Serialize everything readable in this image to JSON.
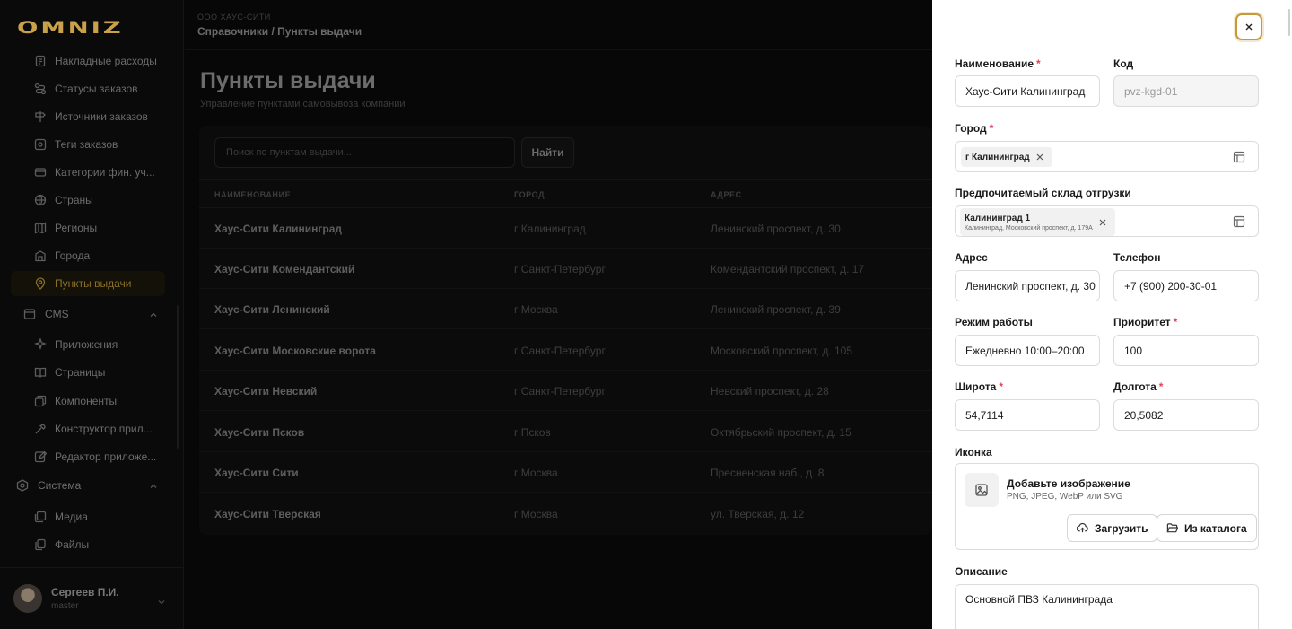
{
  "app": {
    "logo": "OMNIZ"
  },
  "sidebar": {
    "items": [
      {
        "label": "Накладные расходы",
        "icon": "receipt-icon"
      },
      {
        "label": "Статусы заказов",
        "icon": "route-icon"
      },
      {
        "label": "Источники заказов",
        "icon": "signpost-icon"
      },
      {
        "label": "Теги заказов",
        "icon": "tag-icon"
      },
      {
        "label": "Категории фин. уч...",
        "icon": "wallet-icon"
      },
      {
        "label": "Страны",
        "icon": "globe-icon"
      },
      {
        "label": "Регионы",
        "icon": "map-icon"
      },
      {
        "label": "Города",
        "icon": "building-icon"
      },
      {
        "label": "Пункты выдачи",
        "icon": "pin-icon",
        "active": true
      }
    ],
    "cms": {
      "label": "CMS",
      "items": [
        {
          "label": "Приложения",
          "icon": "sparkle-icon"
        },
        {
          "label": "Страницы",
          "icon": "book-icon"
        },
        {
          "label": "Компоненты",
          "icon": "puzzle-icon"
        },
        {
          "label": "Конструктор прил...",
          "icon": "tools-icon"
        },
        {
          "label": "Редактор приложе...",
          "icon": "edit-icon"
        }
      ]
    },
    "system": {
      "label": "Система",
      "items": [
        {
          "label": "Медиа",
          "icon": "images-icon"
        },
        {
          "label": "Файлы",
          "icon": "files-icon"
        }
      ]
    },
    "user": {
      "name": "Сергеев П.И.",
      "role": "master"
    }
  },
  "header": {
    "company": "ООО ХАУС-СИТИ",
    "breadcrumb": "Справочники / Пункты выдачи"
  },
  "page": {
    "title": "Пункты выдачи",
    "subtitle": "Управление пунктами самовывоза компании"
  },
  "search": {
    "placeholder": "Поиск по пунктам выдачи...",
    "button": "Найти"
  },
  "table": {
    "columns": [
      "НАИМЕНОВАНИЕ",
      "ГОРОД",
      "АДРЕС"
    ],
    "rows": [
      [
        "Хаус-Сити Калининград",
        "г Калининград",
        "Ленинский проспект, д. 30"
      ],
      [
        "Хаус-Сити Комендантский",
        "г Санкт-Петербург",
        "Комендантский проспект, д. 17"
      ],
      [
        "Хаус-Сити Ленинский",
        "г Москва",
        "Ленинский проспект, д. 39"
      ],
      [
        "Хаус-Сити Московские ворота",
        "г Санкт-Петербург",
        "Московский проспект, д. 105"
      ],
      [
        "Хаус-Сити Невский",
        "г Санкт-Петербург",
        "Невский проспект, д. 28"
      ],
      [
        "Хаус-Сити Псков",
        "г Псков",
        "Октябрьский проспект, д. 15"
      ],
      [
        "Хаус-Сити Сити",
        "г Москва",
        "Пресненская наб., д. 8"
      ],
      [
        "Хаус-Сити Тверская",
        "г Москва",
        "ул. Тверская, д. 12"
      ]
    ]
  },
  "form": {
    "name": {
      "label": "Наименование",
      "value": "Хаус-Сити Калининград"
    },
    "code": {
      "label": "Код",
      "value": "pvz-kgd-01"
    },
    "city": {
      "label": "Город",
      "chip": "г Калининград"
    },
    "warehouse": {
      "label": "Предпочитаемый склад отгрузки",
      "chip_title": "Калининград 1",
      "chip_sub": "Калининград, Московский проспект, д. 179А"
    },
    "address": {
      "label": "Адрес",
      "value": "Ленинский проспект, д. 30"
    },
    "phone": {
      "label": "Телефон",
      "value": "+7 (900) 200-30-01"
    },
    "hours": {
      "label": "Режим работы",
      "value": "Ежедневно 10:00–20:00"
    },
    "priority": {
      "label": "Приоритет",
      "value": "100"
    },
    "lat": {
      "label": "Широта",
      "value": "54,7114"
    },
    "lon": {
      "label": "Долгота",
      "value": "20,5082"
    },
    "icon": {
      "label": "Иконка",
      "title": "Добавьте изображение",
      "hint": "PNG, JPEG, WebP или SVG",
      "upload": "Загрузить",
      "catalog": "Из каталога"
    },
    "description": {
      "label": "Описание",
      "value": "Основной ПВЗ Калининграда"
    },
    "required_mark": "*"
  },
  "colors": {
    "accent": "#c49a3a",
    "required": "#e0455a",
    "background": "#070707",
    "drawer": "#ffffff"
  }
}
